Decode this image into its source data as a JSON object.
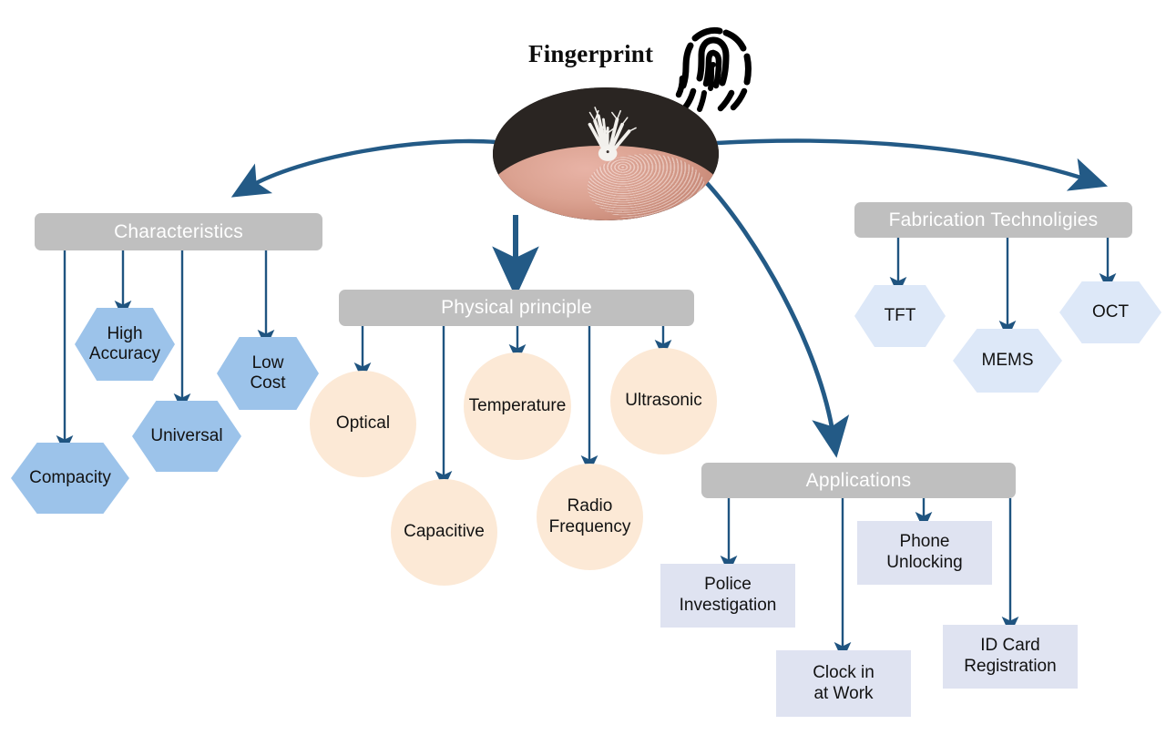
{
  "title": "Fingerprint",
  "icons": {
    "fingerprint": "fingerprint-icon",
    "photo": "fingerprint-photo"
  },
  "colors": {
    "arrow": "#1f5480",
    "bar": "#bfbfbf",
    "bar_text": "#ffffff",
    "hex_blue": "#9cc3ea",
    "hex_pale": "#dde8f8",
    "circle": "#fce9d6",
    "rect": "#dfe3f1",
    "text": "#121212"
  },
  "branches": [
    {
      "id": "characteristics",
      "label": "Characteristics",
      "nodes": [
        {
          "id": "compacity",
          "label": "Compacity",
          "shape": "hexagon"
        },
        {
          "id": "high-accuracy",
          "label": "High\nAccuracy",
          "line1": "High",
          "line2": "Accuracy",
          "shape": "hexagon"
        },
        {
          "id": "universal",
          "label": "Universal",
          "shape": "hexagon"
        },
        {
          "id": "low-cost",
          "label": "Low\nCost",
          "line1": "Low",
          "line2": "Cost",
          "shape": "hexagon"
        }
      ]
    },
    {
      "id": "physical-principle",
      "label": "Physical principle",
      "nodes": [
        {
          "id": "optical",
          "label": "Optical",
          "shape": "circle"
        },
        {
          "id": "capacitive",
          "label": "Capacitive",
          "shape": "circle"
        },
        {
          "id": "temperature",
          "label": "Temperature",
          "shape": "circle"
        },
        {
          "id": "radio-frequency",
          "label": "Radio\nFrequency",
          "line1": "Radio",
          "line2": "Frequency",
          "shape": "circle"
        },
        {
          "id": "ultrasonic",
          "label": "Ultrasonic",
          "shape": "circle"
        }
      ]
    },
    {
      "id": "applications",
      "label": "Applications",
      "nodes": [
        {
          "id": "police-investigation",
          "label": "Police\nInvestigation",
          "line1": "Police",
          "line2": "Investigation",
          "shape": "rectangle"
        },
        {
          "id": "clock-in-at-work",
          "label": "Clock in\nat Work",
          "line1": "Clock in",
          "line2": "at Work",
          "shape": "rectangle"
        },
        {
          "id": "phone-unlocking",
          "label": "Phone\nUnlocking",
          "line1": "Phone",
          "line2": "Unlocking",
          "shape": "rectangle"
        },
        {
          "id": "id-card-registration",
          "label": "ID Card\nRegistration",
          "line1": "ID Card",
          "line2": "Registration",
          "shape": "rectangle"
        }
      ]
    },
    {
      "id": "fabrication-technoligies",
      "label": "Fabrication Technoligies",
      "nodes": [
        {
          "id": "tft",
          "label": "TFT",
          "shape": "hexagon"
        },
        {
          "id": "mems",
          "label": "MEMS",
          "shape": "hexagon"
        },
        {
          "id": "oct",
          "label": "OCT",
          "shape": "hexagon"
        }
      ]
    }
  ]
}
